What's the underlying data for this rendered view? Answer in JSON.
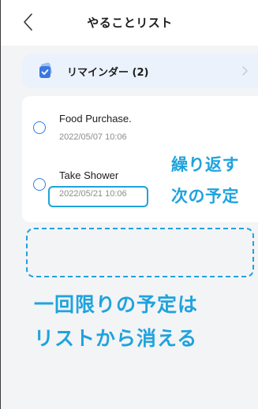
{
  "header": {
    "title": "やることリスト",
    "back_icon": "chevron-left-icon"
  },
  "reminder_group": {
    "label": "リマインダー (2)",
    "icon": "reminder-list-icon",
    "chevron_icon": "chevron-right-icon"
  },
  "tasks": [
    {
      "title": "Food Purchase.",
      "date": "2022/05/07 10:06"
    },
    {
      "title": "Take Shower",
      "date": "2022/05/21 10:06"
    }
  ],
  "annotations": {
    "repeat_note_line1": "繰り返す",
    "repeat_note_line2": "次の予定",
    "caption_line1": "一回限りの予定は",
    "caption_line2": "リストから消える"
  },
  "colors": {
    "accent": "#1fa3dd",
    "radio": "#2f7fe0",
    "icon": "#3a78e0",
    "background": "#f3f4f6",
    "group_background": "#ebf2fb"
  }
}
